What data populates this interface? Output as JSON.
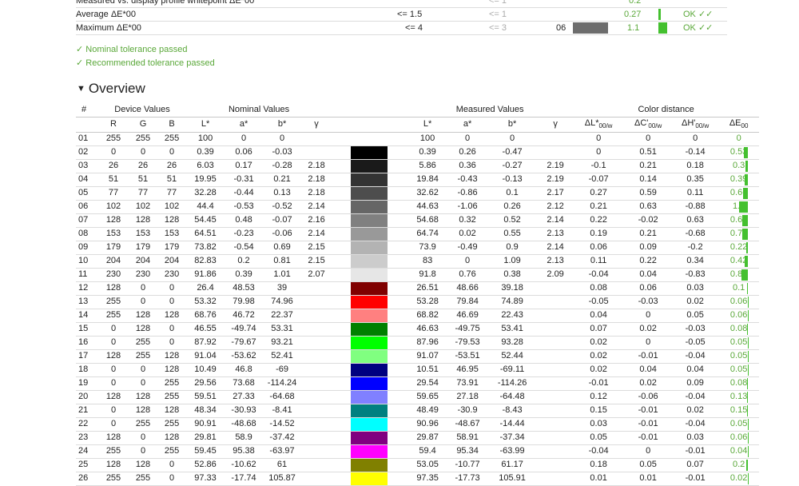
{
  "summary": {
    "rows": [
      {
        "label": "Measured vs. display profile whitepoint ΔE*00",
        "nominal": "",
        "recommended": "<= 1",
        "measured_val": "",
        "value": "0.2",
        "status": ""
      },
      {
        "label": "Average ΔE*00",
        "nominal": "<= 1.5",
        "recommended": "<= 1",
        "measured_val": "",
        "value": "0.27",
        "status": "OK ✓✓"
      },
      {
        "label": "Maximum ΔE*00",
        "nominal": "<= 4",
        "recommended": "<= 3",
        "measured_val": "06",
        "value": "1.1",
        "status": "OK ✓✓"
      }
    ],
    "messages": [
      "✓ Nominal tolerance passed",
      "✓ Recommended tolerance passed"
    ]
  },
  "overview": {
    "title": "Overview",
    "groups": {
      "num": "#",
      "device": "Device Values",
      "nominal": "Nominal Values",
      "measured": "Measured Values",
      "distance": "Color distance"
    },
    "columns": {
      "r": "R",
      "g": "G",
      "b": "B",
      "L": "L*",
      "a": "a*",
      "bstar": "b*",
      "gamma": "γ",
      "dL": "ΔL*",
      "dC": "ΔC'",
      "dH": "ΔH'",
      "dE": "ΔE",
      "sub": "00/w",
      "sub_e": "00"
    },
    "rows": [
      {
        "n": "01",
        "r": "255",
        "g": "255",
        "b": "255",
        "L": "100",
        "a": "0",
        "bs": "0",
        "gm": "",
        "mL": "100",
        "ma": "0",
        "mb": "0",
        "mg": "",
        "dL": "0",
        "dC": "0",
        "dH": "0",
        "dE": "0",
        "color": "#ffffff"
      },
      {
        "n": "02",
        "r": "0",
        "g": "0",
        "b": "0",
        "L": "0.39",
        "a": "0.06",
        "bs": "-0.03",
        "gm": "",
        "mL": "0.39",
        "ma": "0.26",
        "mb": "-0.47",
        "mg": "",
        "dL": "0",
        "dC": "0.51",
        "dH": "-0.14",
        "dE": "0.53",
        "color": "#000000"
      },
      {
        "n": "03",
        "r": "26",
        "g": "26",
        "b": "26",
        "L": "6.03",
        "a": "0.17",
        "bs": "-0.28",
        "gm": "2.18",
        "mL": "5.86",
        "ma": "0.36",
        "mb": "-0.27",
        "mg": "2.19",
        "dL": "-0.1",
        "dC": "0.21",
        "dH": "0.18",
        "dE": "0.3",
        "color": "#1a1a1a"
      },
      {
        "n": "04",
        "r": "51",
        "g": "51",
        "b": "51",
        "L": "19.95",
        "a": "-0.31",
        "bs": "0.21",
        "gm": "2.18",
        "mL": "19.84",
        "ma": "-0.43",
        "mb": "-0.13",
        "mg": "2.19",
        "dL": "-0.07",
        "dC": "0.14",
        "dH": "0.35",
        "dE": "0.39",
        "color": "#333333"
      },
      {
        "n": "05",
        "r": "77",
        "g": "77",
        "b": "77",
        "L": "32.28",
        "a": "-0.44",
        "bs": "0.13",
        "gm": "2.18",
        "mL": "32.62",
        "ma": "-0.86",
        "mb": "0.1",
        "mg": "2.17",
        "dL": "0.27",
        "dC": "0.59",
        "dH": "0.11",
        "dE": "0.66",
        "color": "#4d4d4d"
      },
      {
        "n": "06",
        "r": "102",
        "g": "102",
        "b": "102",
        "L": "44.4",
        "a": "-0.53",
        "bs": "-0.52",
        "gm": "2.14",
        "mL": "44.63",
        "ma": "-1.06",
        "mb": "0.26",
        "mg": "2.12",
        "dL": "0.21",
        "dC": "0.63",
        "dH": "-0.88",
        "dE": "1.1",
        "color": "#666666"
      },
      {
        "n": "07",
        "r": "128",
        "g": "128",
        "b": "128",
        "L": "54.45",
        "a": "0.48",
        "bs": "-0.07",
        "gm": "2.16",
        "mL": "54.68",
        "ma": "0.32",
        "mb": "0.52",
        "mg": "2.14",
        "dL": "0.22",
        "dC": "-0.02",
        "dH": "0.63",
        "dE": "0.67",
        "color": "#808080"
      },
      {
        "n": "08",
        "r": "153",
        "g": "153",
        "b": "153",
        "L": "64.51",
        "a": "-0.23",
        "bs": "-0.06",
        "gm": "2.14",
        "mL": "64.74",
        "ma": "0.02",
        "mb": "0.55",
        "mg": "2.13",
        "dL": "0.19",
        "dC": "0.21",
        "dH": "-0.68",
        "dE": "0.74",
        "color": "#999999"
      },
      {
        "n": "09",
        "r": "179",
        "g": "179",
        "b": "179",
        "L": "73.82",
        "a": "-0.54",
        "bs": "0.69",
        "gm": "2.15",
        "mL": "73.9",
        "ma": "-0.49",
        "mb": "0.9",
        "mg": "2.14",
        "dL": "0.06",
        "dC": "0.09",
        "dH": "-0.2",
        "dE": "0.22",
        "color": "#b3b3b3"
      },
      {
        "n": "10",
        "r": "204",
        "g": "204",
        "b": "204",
        "L": "82.83",
        "a": "0.2",
        "bs": "0.81",
        "gm": "2.15",
        "mL": "83",
        "ma": "0",
        "mb": "1.09",
        "mg": "2.13",
        "dL": "0.11",
        "dC": "0.22",
        "dH": "0.34",
        "dE": "0.42",
        "color": "#cccccc"
      },
      {
        "n": "11",
        "r": "230",
        "g": "230",
        "b": "230",
        "L": "91.86",
        "a": "0.39",
        "bs": "1.01",
        "gm": "2.07",
        "mL": "91.8",
        "ma": "0.76",
        "mb": "0.38",
        "mg": "2.09",
        "dL": "-0.04",
        "dC": "0.04",
        "dH": "-0.83",
        "dE": "0.83",
        "color": "#e6e6e6"
      },
      {
        "n": "12",
        "r": "128",
        "g": "0",
        "b": "0",
        "L": "26.4",
        "a": "48.53",
        "bs": "39",
        "gm": "",
        "mL": "26.51",
        "ma": "48.66",
        "mb": "39.18",
        "mg": "",
        "dL": "0.08",
        "dC": "0.06",
        "dH": "0.03",
        "dE": "0.1",
        "color": "#800000"
      },
      {
        "n": "13",
        "r": "255",
        "g": "0",
        "b": "0",
        "L": "53.32",
        "a": "79.98",
        "bs": "74.96",
        "gm": "",
        "mL": "53.28",
        "ma": "79.84",
        "mb": "74.89",
        "mg": "",
        "dL": "-0.05",
        "dC": "-0.03",
        "dH": "0.02",
        "dE": "0.06",
        "color": "#ff0000"
      },
      {
        "n": "14",
        "r": "255",
        "g": "128",
        "b": "128",
        "L": "68.76",
        "a": "46.72",
        "bs": "22.37",
        "gm": "",
        "mL": "68.82",
        "ma": "46.69",
        "mb": "22.43",
        "mg": "",
        "dL": "0.04",
        "dC": "0",
        "dH": "0.05",
        "dE": "0.06",
        "color": "#ff8080"
      },
      {
        "n": "15",
        "r": "0",
        "g": "128",
        "b": "0",
        "L": "46.55",
        "a": "-49.74",
        "bs": "53.31",
        "gm": "",
        "mL": "46.63",
        "ma": "-49.75",
        "mb": "53.41",
        "mg": "",
        "dL": "0.07",
        "dC": "0.02",
        "dH": "-0.03",
        "dE": "0.08",
        "color": "#008000"
      },
      {
        "n": "16",
        "r": "0",
        "g": "255",
        "b": "0",
        "L": "87.92",
        "a": "-79.67",
        "bs": "93.21",
        "gm": "",
        "mL": "87.96",
        "ma": "-79.53",
        "mb": "93.28",
        "mg": "",
        "dL": "0.02",
        "dC": "0",
        "dH": "-0.05",
        "dE": "0.05",
        "color": "#00ff00"
      },
      {
        "n": "17",
        "r": "128",
        "g": "255",
        "b": "128",
        "L": "91.04",
        "a": "-53.62",
        "bs": "52.41",
        "gm": "",
        "mL": "91.07",
        "ma": "-53.51",
        "mb": "52.44",
        "mg": "",
        "dL": "0.02",
        "dC": "-0.01",
        "dH": "-0.04",
        "dE": "0.05",
        "color": "#80ff80"
      },
      {
        "n": "18",
        "r": "0",
        "g": "0",
        "b": "128",
        "L": "10.49",
        "a": "46.8",
        "bs": "-69",
        "gm": "",
        "mL": "10.51",
        "ma": "46.95",
        "mb": "-69.11",
        "mg": "",
        "dL": "0.02",
        "dC": "0.04",
        "dH": "0.04",
        "dE": "0.05",
        "color": "#000080"
      },
      {
        "n": "19",
        "r": "0",
        "g": "0",
        "b": "255",
        "L": "29.56",
        "a": "73.68",
        "bs": "-114.24",
        "gm": "",
        "mL": "29.54",
        "ma": "73.91",
        "mb": "-114.26",
        "mg": "",
        "dL": "-0.01",
        "dC": "0.02",
        "dH": "0.09",
        "dE": "0.08",
        "color": "#0000ff"
      },
      {
        "n": "20",
        "r": "128",
        "g": "128",
        "b": "255",
        "L": "59.51",
        "a": "27.33",
        "bs": "-64.68",
        "gm": "",
        "mL": "59.65",
        "ma": "27.18",
        "mb": "-64.48",
        "mg": "",
        "dL": "0.12",
        "dC": "-0.06",
        "dH": "-0.04",
        "dE": "0.13",
        "color": "#8080ff"
      },
      {
        "n": "21",
        "r": "0",
        "g": "128",
        "b": "128",
        "L": "48.34",
        "a": "-30.93",
        "bs": "-8.41",
        "gm": "",
        "mL": "48.49",
        "ma": "-30.9",
        "mb": "-8.43",
        "mg": "",
        "dL": "0.15",
        "dC": "-0.01",
        "dH": "0.02",
        "dE": "0.15",
        "color": "#008080"
      },
      {
        "n": "22",
        "r": "0",
        "g": "255",
        "b": "255",
        "L": "90.91",
        "a": "-48.68",
        "bs": "-14.52",
        "gm": "",
        "mL": "90.96",
        "ma": "-48.67",
        "mb": "-14.44",
        "mg": "",
        "dL": "0.03",
        "dC": "-0.01",
        "dH": "-0.04",
        "dE": "0.05",
        "color": "#00ffff"
      },
      {
        "n": "23",
        "r": "128",
        "g": "0",
        "b": "128",
        "L": "29.81",
        "a": "58.9",
        "bs": "-37.42",
        "gm": "",
        "mL": "29.87",
        "ma": "58.91",
        "mb": "-37.34",
        "mg": "",
        "dL": "0.05",
        "dC": "-0.01",
        "dH": "0.03",
        "dE": "0.06",
        "color": "#800080"
      },
      {
        "n": "24",
        "r": "255",
        "g": "0",
        "b": "255",
        "L": "59.45",
        "a": "95.38",
        "bs": "-63.97",
        "gm": "",
        "mL": "59.4",
        "ma": "95.34",
        "mb": "-63.99",
        "mg": "",
        "dL": "-0.04",
        "dC": "0",
        "dH": "-0.01",
        "dE": "0.04",
        "color": "#ff00ff"
      },
      {
        "n": "25",
        "r": "128",
        "g": "128",
        "b": "0",
        "L": "52.86",
        "a": "-10.62",
        "bs": "61",
        "gm": "",
        "mL": "53.05",
        "ma": "-10.77",
        "mb": "61.17",
        "mg": "",
        "dL": "0.18",
        "dC": "0.05",
        "dH": "0.07",
        "dE": "0.2",
        "color": "#808000"
      },
      {
        "n": "26",
        "r": "255",
        "g": "255",
        "b": "0",
        "L": "97.33",
        "a": "-17.74",
        "bs": "105.87",
        "gm": "",
        "mL": "97.35",
        "ma": "-17.73",
        "mb": "105.91",
        "mg": "",
        "dL": "0.01",
        "dC": "0.01",
        "dH": "-0.01",
        "dE": "0.02",
        "color": "#ffff00"
      }
    ]
  }
}
